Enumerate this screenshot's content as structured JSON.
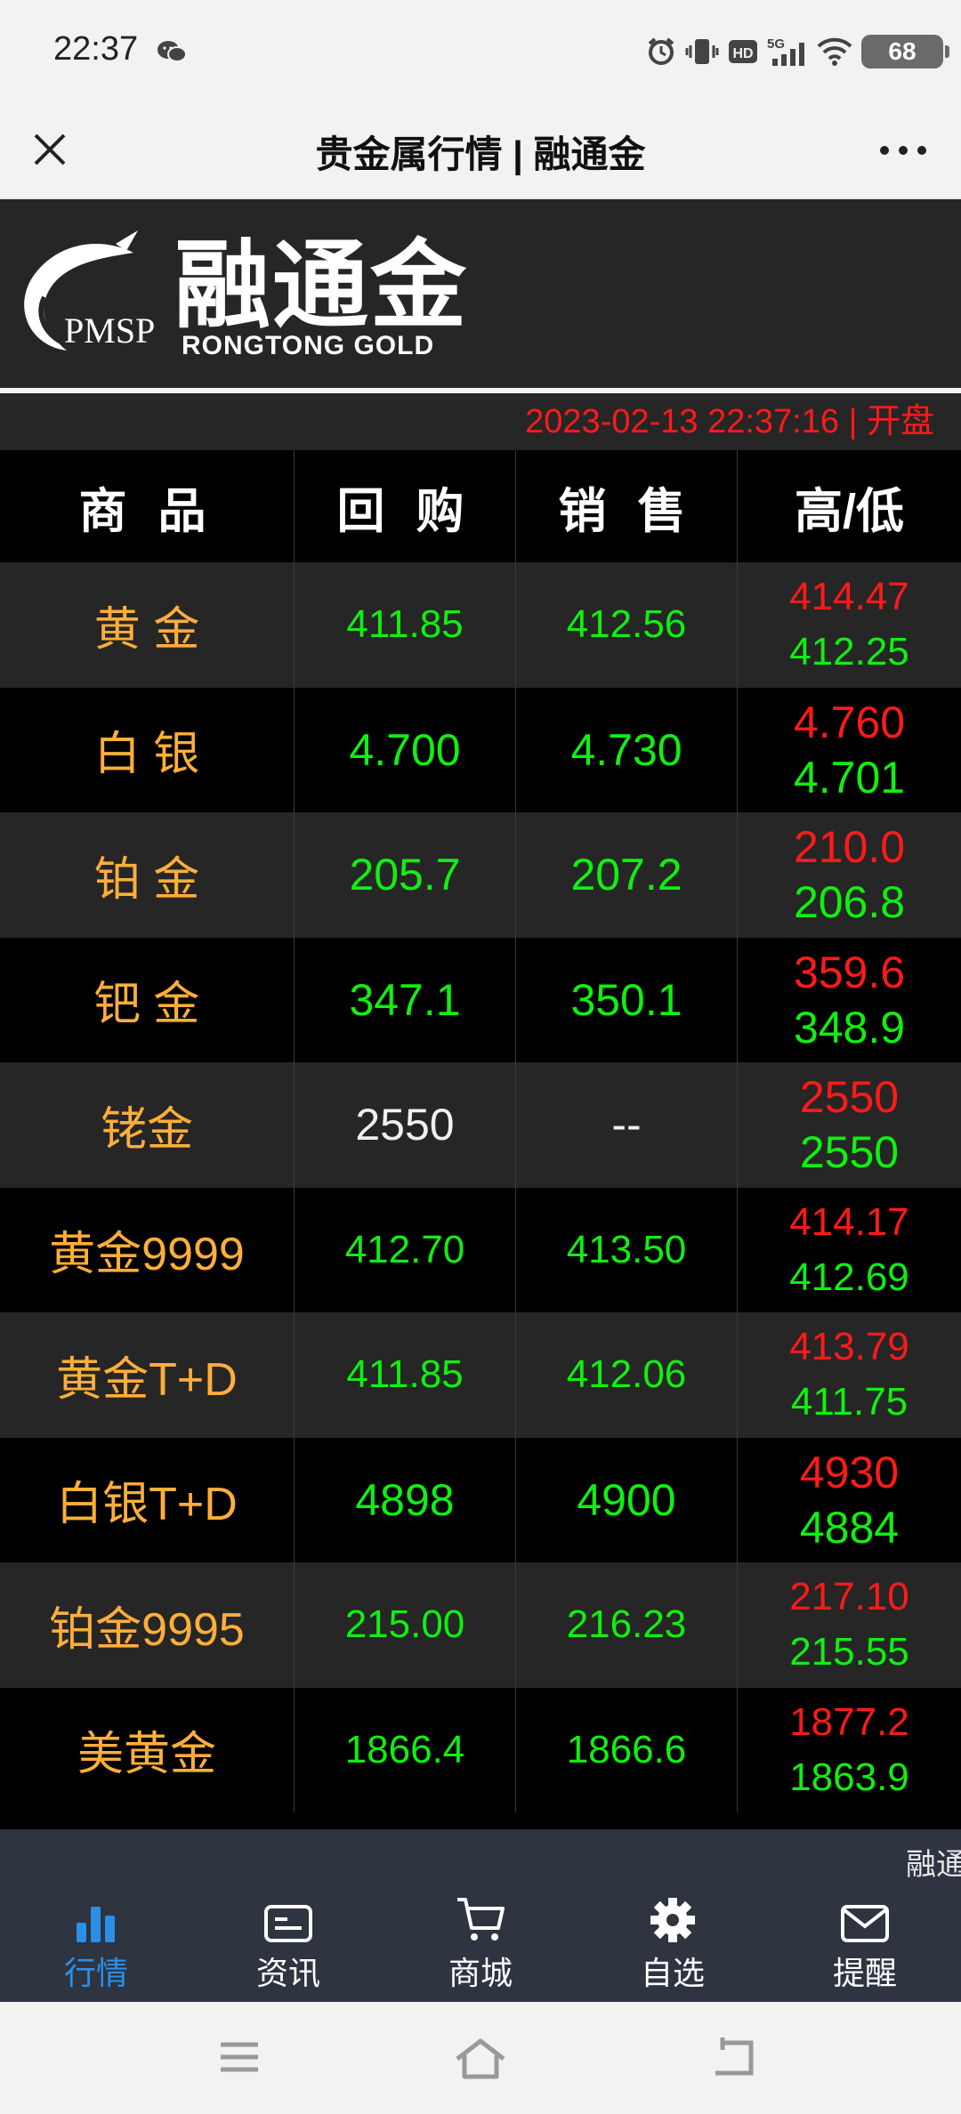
{
  "status_bar": {
    "time": "22:37",
    "battery": "68",
    "network": "5G"
  },
  "title_bar": {
    "title": "贵金属行情 | 融通金"
  },
  "banner": {
    "logo_cn": "融通金",
    "logo_en": "RONGTONG  GOLD",
    "logo_pmsp": "PMSP"
  },
  "date_line": "2023-02-13 22:37:16 | 开盘",
  "table": {
    "headers": [
      "商 品",
      "回 购",
      "销 售",
      "高/低"
    ],
    "rows": [
      {
        "name": "黄 金",
        "buy": "411.85",
        "sell": "412.56",
        "high": "414.47",
        "low": "412.25"
      },
      {
        "name": "白 银",
        "buy": "4.700",
        "sell": "4.730",
        "high": "4.760",
        "low": "4.701"
      },
      {
        "name": "铂 金",
        "buy": "205.7",
        "sell": "207.2",
        "high": "210.0",
        "low": "206.8"
      },
      {
        "name": "钯 金",
        "buy": "347.1",
        "sell": "350.1",
        "high": "359.6",
        "low": "348.9"
      },
      {
        "name": "铑金",
        "buy": "2550",
        "sell": "--",
        "high": "2550",
        "low": "2550"
      },
      {
        "name": "黄金9999",
        "buy": "412.70",
        "sell": "413.50",
        "high": "414.17",
        "low": "412.69"
      },
      {
        "name": "黄金T+D",
        "buy": "411.85",
        "sell": "412.06",
        "high": "413.79",
        "low": "411.75"
      },
      {
        "name": "白银T+D",
        "buy": "4898",
        "sell": "4900",
        "high": "4930",
        "low": "4884"
      },
      {
        "name": "铂金9995",
        "buy": "215.00",
        "sell": "216.23",
        "high": "217.10",
        "low": "215.55"
      },
      {
        "name": "美黄金",
        "buy": "1866.4",
        "sell": "1866.6",
        "high": "1877.2",
        "low": "1863.9"
      }
    ]
  },
  "marquee": "融通",
  "tabbar": {
    "items": [
      {
        "label": "行情",
        "icon": "bar-chart-icon",
        "active": true
      },
      {
        "label": "资讯",
        "icon": "news-card-icon",
        "active": false
      },
      {
        "label": "商城",
        "icon": "cart-icon",
        "active": false
      },
      {
        "label": "自选",
        "icon": "gear-icon",
        "active": false
      },
      {
        "label": "提醒",
        "icon": "mail-icon",
        "active": false
      }
    ]
  },
  "colors": {
    "accent_blue": "#2b8fe8",
    "price_green": "#10f010",
    "price_red": "#ff1a1a",
    "name_orange": "#ffae3a",
    "row_dark": "#262626",
    "tabbar_bg": "#2e3440"
  }
}
